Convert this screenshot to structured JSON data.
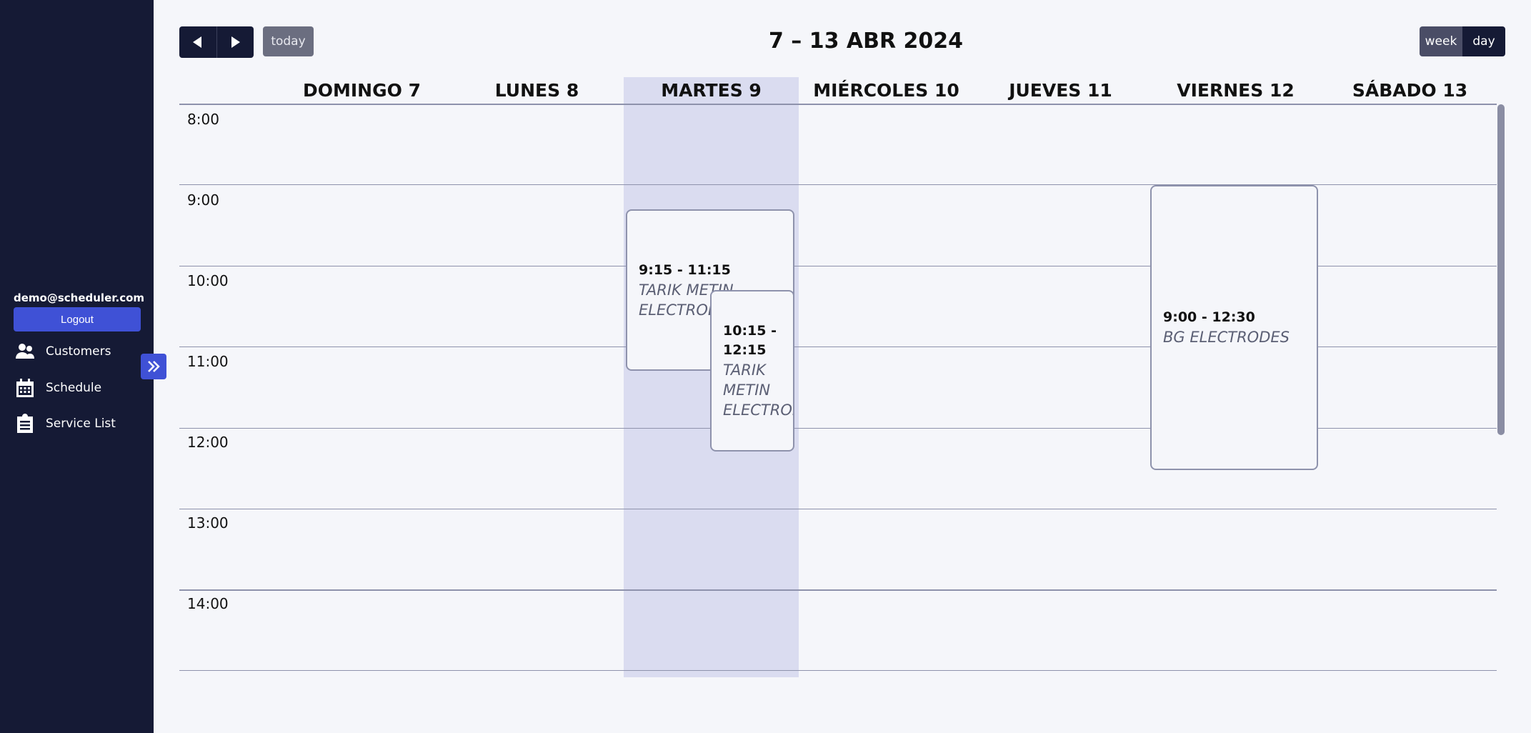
{
  "sidebar": {
    "user_email": "demo@scheduler.com",
    "logout_label": "Logout",
    "items": [
      {
        "label": "Customers",
        "icon": "users-icon"
      },
      {
        "label": "Schedule",
        "icon": "calendar-icon"
      },
      {
        "label": "Service List",
        "icon": "clipboard-icon"
      }
    ],
    "expand_icon": "double-chevron-right-icon"
  },
  "toolbar": {
    "prev_icon": "triangle-left-icon",
    "next_icon": "triangle-right-icon",
    "today_label": "today",
    "title": "7 – 13 ABR 2024",
    "views": [
      {
        "label": "week",
        "active": true
      },
      {
        "label": "day",
        "active": false
      }
    ]
  },
  "calendar": {
    "days": [
      "DOMINGO 7",
      "LUNES 8",
      "MARTES 9",
      "MIÉRCOLES 10",
      "JUEVES 11",
      "VIERNES 12",
      "SÁBADO 13"
    ],
    "today_day": "MARTES 9",
    "times": [
      "8:00",
      "9:00",
      "10:00",
      "11:00",
      "12:00",
      "13:00",
      "14:00"
    ],
    "events": [
      {
        "time": "9:15 - 11:15",
        "title": "TARIK METIN ELECTRODES",
        "day": "MARTES 9"
      },
      {
        "time": "10:15 - 12:15",
        "title": "TARIK METIN ELECTRODES",
        "day": "MARTES 9"
      },
      {
        "time": "9:00 - 12:30",
        "title": "BG ELECTRODES",
        "day": "VIERNES 12"
      }
    ]
  },
  "colors": {
    "sidebar_bg": "#151a35",
    "accent": "#3f51d6",
    "today_column": "#dadcf0",
    "page_bg": "#f5f6fa"
  }
}
